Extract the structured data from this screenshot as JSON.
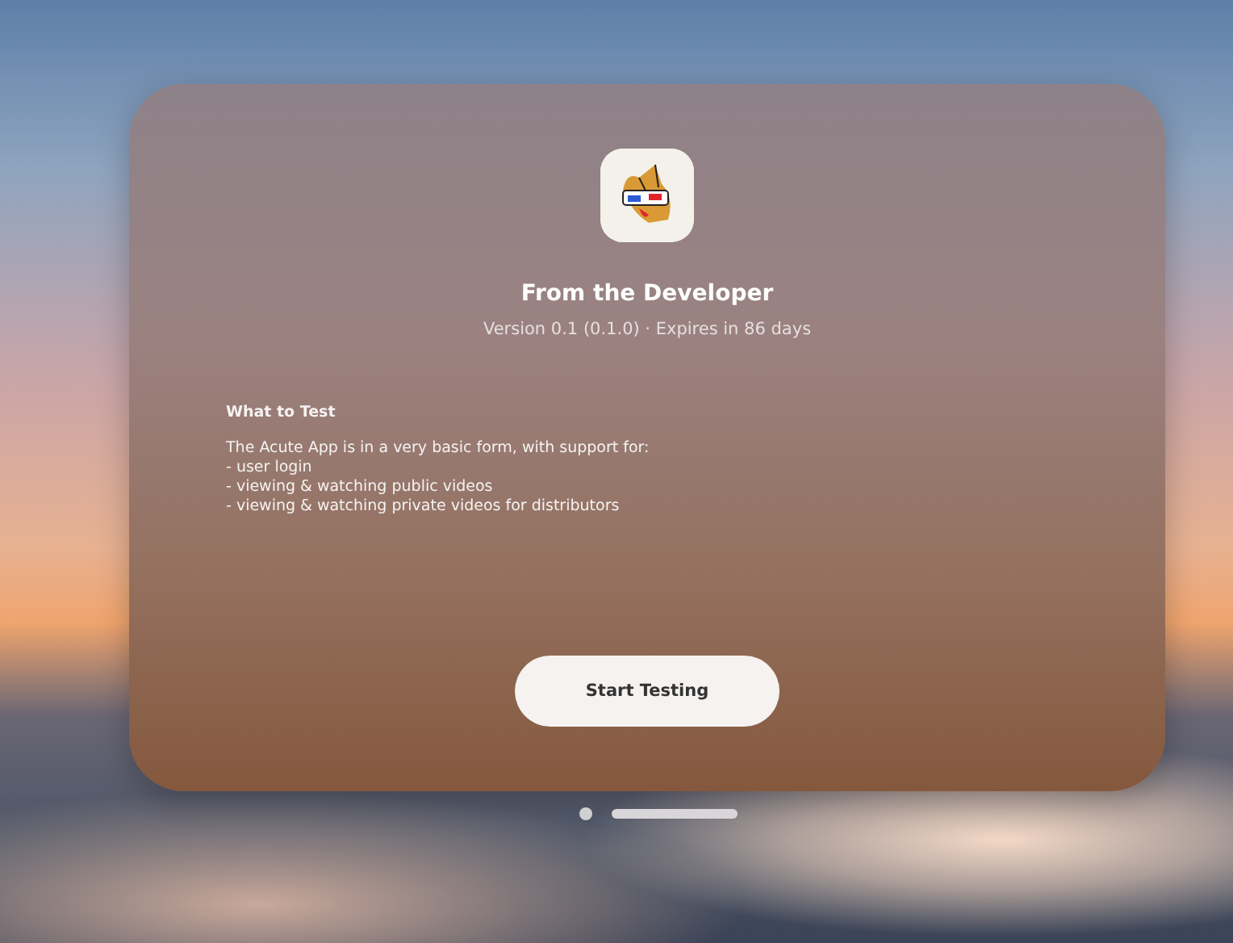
{
  "window": {
    "title": "From the Developer",
    "subtitle": "Version 0.1 (0.1.0) · Expires in 86 days"
  },
  "notes": {
    "heading": "What to Test",
    "intro": "The Acute App is in a very basic form, with support for:",
    "items": [
      "- user login",
      "- viewing & watching public videos",
      "- viewing & watching private videos for distributors"
    ]
  },
  "button": {
    "label": "Start Testing"
  }
}
